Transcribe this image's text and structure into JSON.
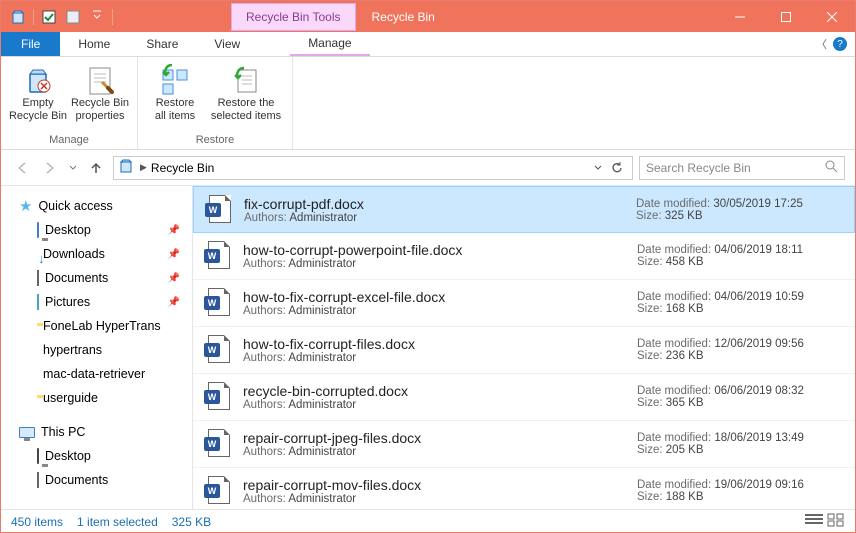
{
  "window": {
    "title": "Recycle Bin",
    "tool_tab": "Recycle Bin Tools"
  },
  "tabs": {
    "file": "File",
    "home": "Home",
    "share": "Share",
    "view": "View",
    "manage": "Manage"
  },
  "ribbon": {
    "groups": [
      {
        "name": "Manage",
        "buttons": [
          {
            "id": "empty",
            "line1": "Empty",
            "line2": "Recycle Bin"
          },
          {
            "id": "props",
            "line1": "Recycle Bin",
            "line2": "properties"
          }
        ]
      },
      {
        "name": "Restore",
        "buttons": [
          {
            "id": "restore_all",
            "line1": "Restore",
            "line2": "all items"
          },
          {
            "id": "restore_sel",
            "line1": "Restore the",
            "line2": "selected items"
          }
        ]
      }
    ]
  },
  "address": {
    "crumb1": "Recycle Bin"
  },
  "search": {
    "placeholder": "Search Recycle Bin"
  },
  "nav": {
    "quick": "Quick access",
    "quick_items": [
      {
        "label": "Desktop",
        "pin": true,
        "icon": "desktop"
      },
      {
        "label": "Downloads",
        "pin": true,
        "icon": "download"
      },
      {
        "label": "Documents",
        "pin": true,
        "icon": "document"
      },
      {
        "label": "Pictures",
        "pin": true,
        "icon": "pictures"
      },
      {
        "label": "FoneLab HyperTrans",
        "pin": false,
        "icon": "folder"
      },
      {
        "label": "hypertrans",
        "pin": false,
        "icon": "green"
      },
      {
        "label": "mac-data-retriever",
        "pin": false,
        "icon": "green"
      },
      {
        "label": "userguide",
        "pin": false,
        "icon": "folder"
      }
    ],
    "this_pc": "This PC",
    "pc_items": [
      {
        "label": "Desktop",
        "icon": "desktop-dark"
      },
      {
        "label": "Documents",
        "icon": "document"
      }
    ]
  },
  "files": [
    {
      "name": "fix-corrupt-pdf.docx",
      "authors_lbl": "Authors:",
      "author": "Administrator",
      "dm_lbl": "Date modified:",
      "date": "30/05/2019 17:25",
      "sz_lbl": "Size:",
      "size": "325 KB",
      "selected": true
    },
    {
      "name": "how-to-corrupt-powerpoint-file.docx",
      "authors_lbl": "Authors:",
      "author": "Administrator",
      "dm_lbl": "Date modified:",
      "date": "04/06/2019 18:11",
      "sz_lbl": "Size:",
      "size": "458 KB",
      "selected": false
    },
    {
      "name": "how-to-fix-corrupt-excel-file.docx",
      "authors_lbl": "Authors:",
      "author": "Administrator",
      "dm_lbl": "Date modified:",
      "date": "04/06/2019 10:59",
      "sz_lbl": "Size:",
      "size": "168 KB",
      "selected": false
    },
    {
      "name": "how-to-fix-corrupt-files.docx",
      "authors_lbl": "Authors:",
      "author": "Administrator",
      "dm_lbl": "Date modified:",
      "date": "12/06/2019 09:56",
      "sz_lbl": "Size:",
      "size": "236 KB",
      "selected": false
    },
    {
      "name": "recycle-bin-corrupted.docx",
      "authors_lbl": "Authors:",
      "author": "Administrator",
      "dm_lbl": "Date modified:",
      "date": "06/06/2019 08:32",
      "sz_lbl": "Size:",
      "size": "365 KB",
      "selected": false
    },
    {
      "name": "repair-corrupt-jpeg-files.docx",
      "authors_lbl": "Authors:",
      "author": "Administrator",
      "dm_lbl": "Date modified:",
      "date": "18/06/2019 13:49",
      "sz_lbl": "Size:",
      "size": "205 KB",
      "selected": false
    },
    {
      "name": "repair-corrupt-mov-files.docx",
      "authors_lbl": "Authors:",
      "author": "Administrator",
      "dm_lbl": "Date modified:",
      "date": "19/06/2019 09:16",
      "sz_lbl": "Size:",
      "size": "188 KB",
      "selected": false
    }
  ],
  "status": {
    "count": "450 items",
    "sel": "1 item selected",
    "size": "325 KB"
  }
}
